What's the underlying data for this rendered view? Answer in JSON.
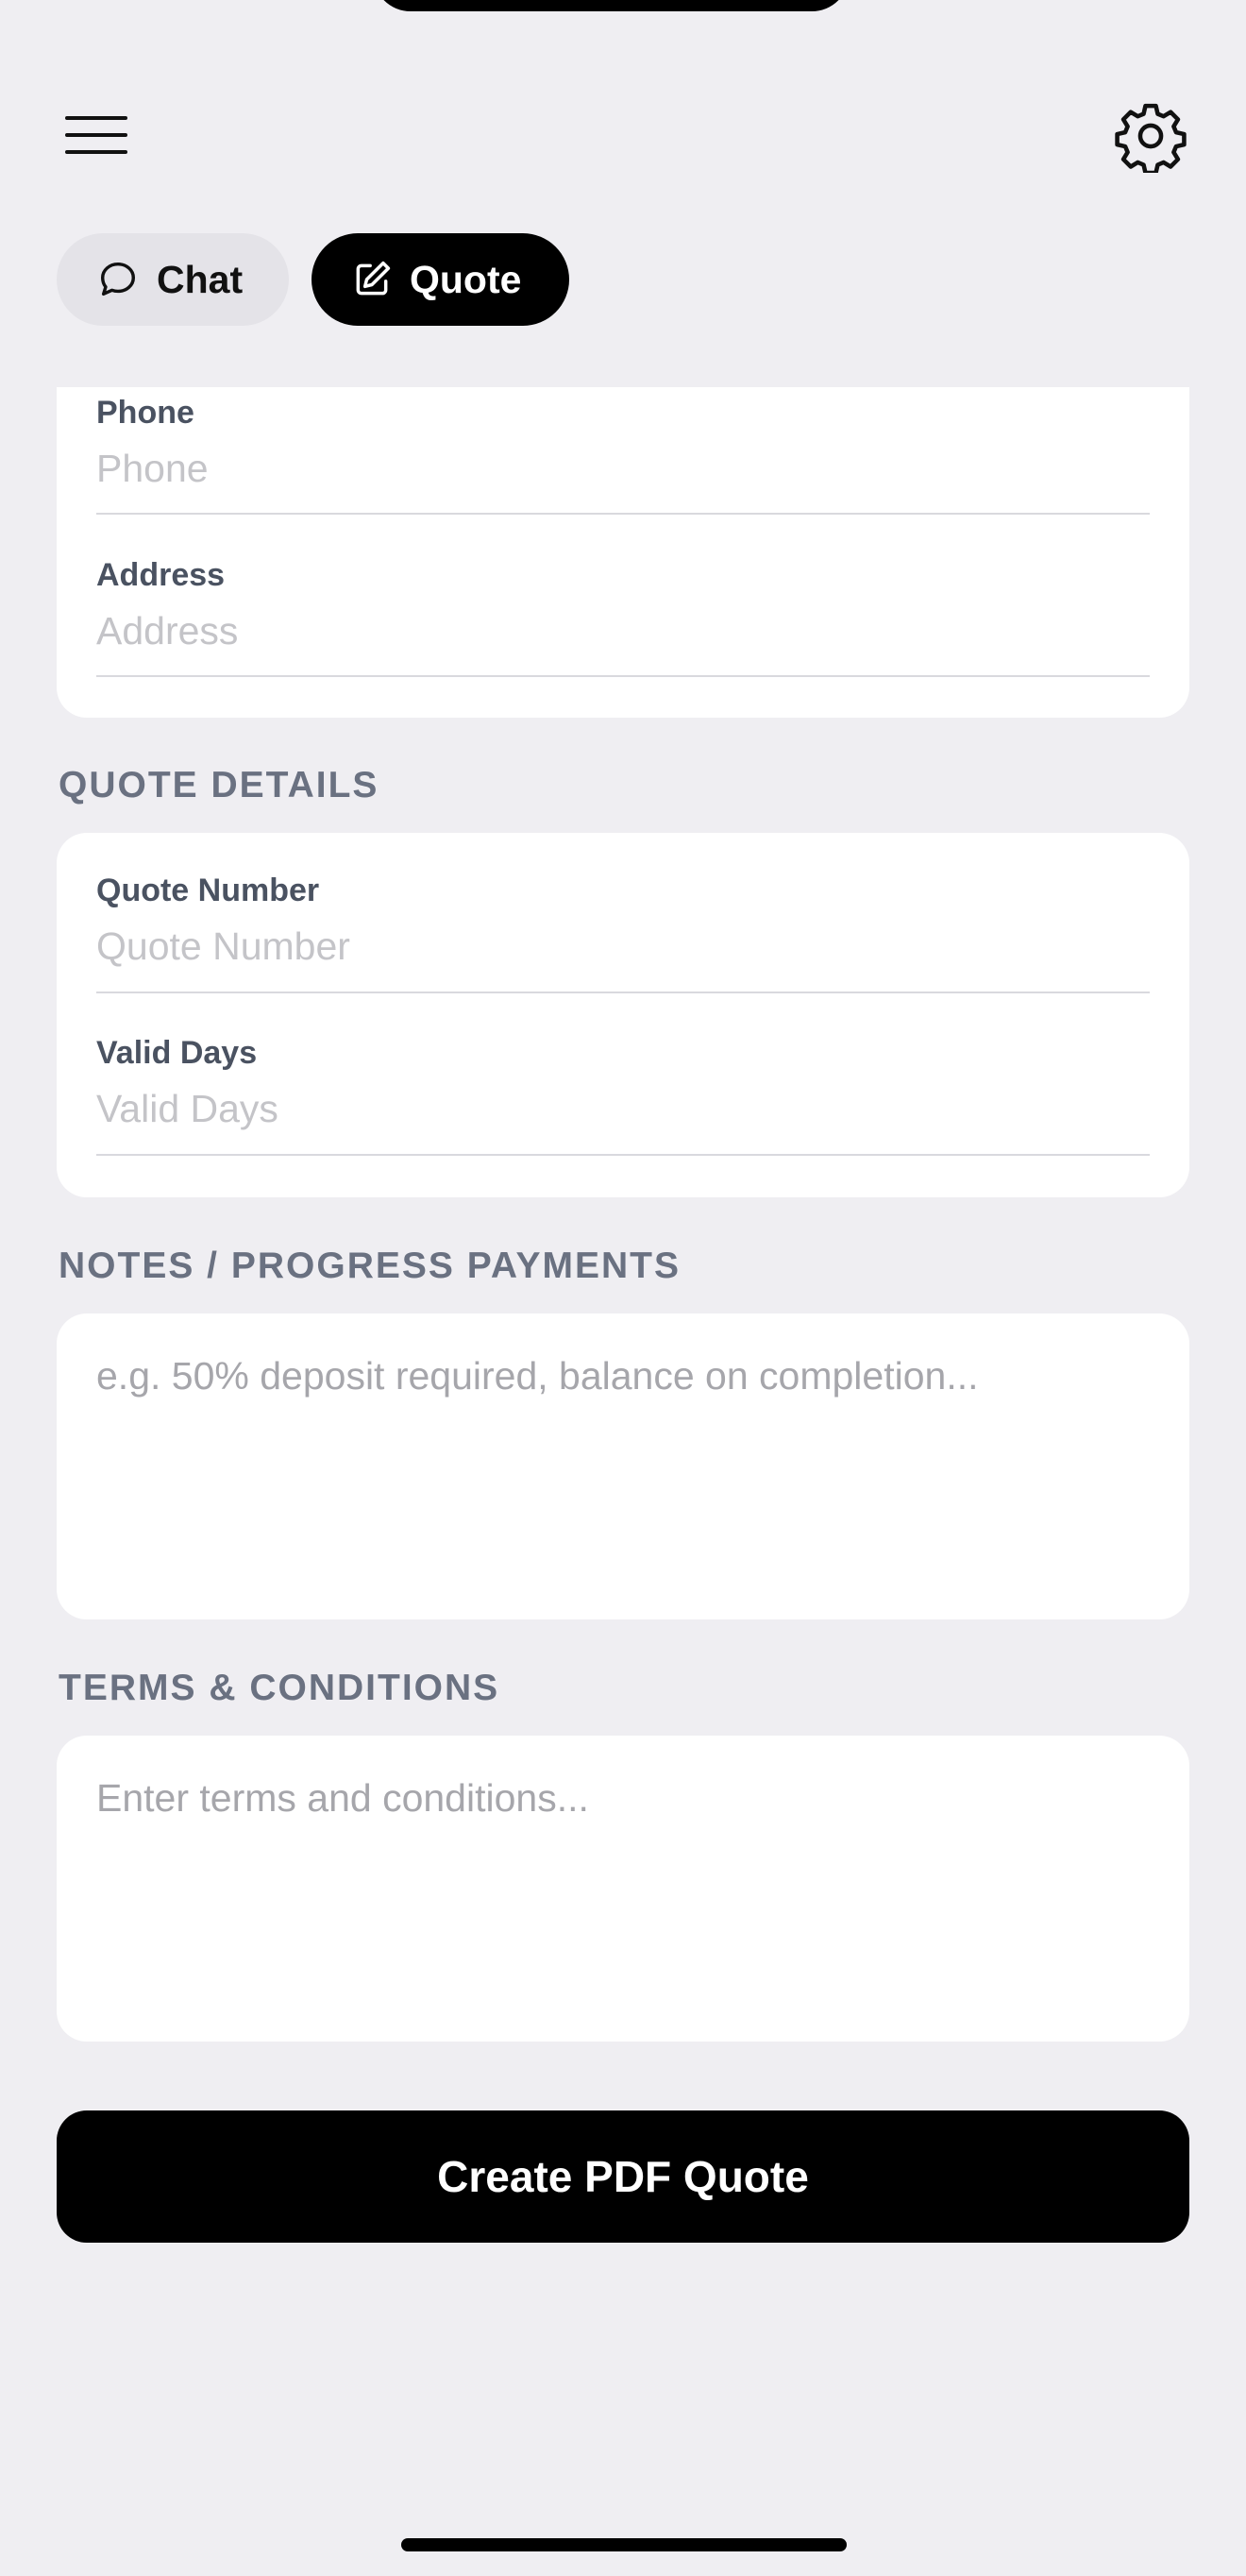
{
  "header": {
    "menu_icon": "hamburger-menu-icon",
    "settings_icon": "gear-icon"
  },
  "mode_switch": {
    "chat_label": "Chat",
    "chat_icon": "chat-bubble-icon",
    "quote_label": "Quote",
    "quote_icon": "edit-square-icon",
    "selected": "Quote"
  },
  "contact": {
    "phone_label": "Phone",
    "phone_placeholder": "Phone",
    "address_label": "Address",
    "address_placeholder": "Address"
  },
  "quote_details": {
    "section_title": "QUOTE DETAILS",
    "quote_number_label": "Quote Number",
    "quote_number_placeholder": "Quote Number",
    "valid_days_label": "Valid Days",
    "valid_days_placeholder": "Valid Days"
  },
  "notes": {
    "section_title": "NOTES / PROGRESS PAYMENTS",
    "placeholder": "e.g. 50% deposit required, balance on completion..."
  },
  "terms": {
    "section_title": "TERMS & CONDITIONS",
    "placeholder": "Enter terms and conditions..."
  },
  "actions": {
    "create_pdf_label": "Create PDF Quote"
  },
  "colors": {
    "background": "#efeef2",
    "card": "#ffffff",
    "primary": "#000000",
    "section_title": "#6a7181",
    "placeholder": "#c4c4c8"
  }
}
